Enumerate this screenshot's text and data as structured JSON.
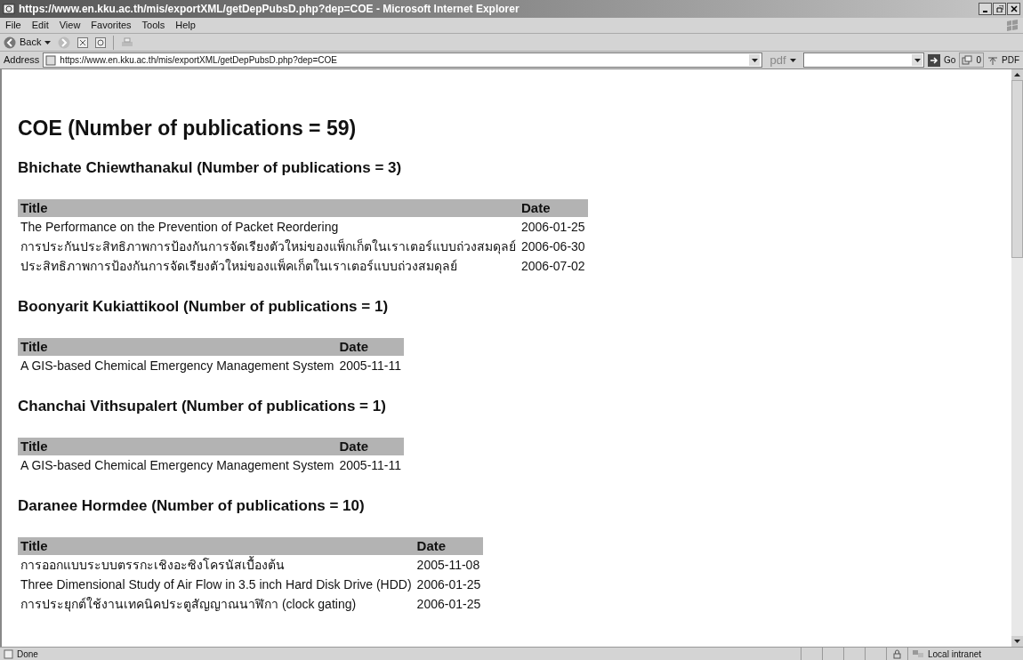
{
  "window": {
    "title": "https://www.en.kku.ac.th/mis/exportXML/getDepPubsD.php?dep=COE - Microsoft Internet Explorer"
  },
  "menu": [
    "File",
    "Edit",
    "View",
    "Favorites",
    "Tools",
    "Help"
  ],
  "toolbar": {
    "back_label": "Back"
  },
  "address_bar": {
    "label": "Address",
    "url": "https://www.en.kku.ac.th/mis/exportXML/getDepPubsD.php?dep=COE",
    "search_label": "pdf",
    "go_label": "Go",
    "count": "0",
    "pdf_label": "PDF"
  },
  "page": {
    "heading": "COE (Number of publications = 59)",
    "sections": [
      {
        "heading": "Bhichate Chiewthanakul (Number of publications = 3)",
        "columns": [
          "Title",
          "Date"
        ],
        "rows": [
          [
            "The Performance on the Prevention of Packet Reordering",
            "2006-01-25"
          ],
          [
            "การประกันประสิทธิภาพการป้องกันการจัดเรียงตัวใหม่ของแพ็กเก็ตในเราเตอร์แบบถ่วงสมดุลย์",
            "2006-06-30"
          ],
          [
            "ประสิทธิภาพการป้องกันการจัดเรียงตัวใหม่ของแพ็คเก็ตในเราเตอร์แบบถ่วงสมดุลย์",
            "2006-07-02"
          ]
        ]
      },
      {
        "heading": "Boonyarit Kukiattikool (Number of publications = 1)",
        "columns": [
          "Title",
          "Date"
        ],
        "rows": [
          [
            "A GIS-based Chemical Emergency Management System",
            "2005-11-11"
          ]
        ]
      },
      {
        "heading": "Chanchai Vithsupalert (Number of publications = 1)",
        "columns": [
          "Title",
          "Date"
        ],
        "rows": [
          [
            "A GIS-based Chemical Emergency Management System",
            "2005-11-11"
          ]
        ]
      },
      {
        "heading": "Daranee Hormdee (Number of publications = 10)",
        "columns": [
          "Title",
          "Date"
        ],
        "rows": [
          [
            "การออกแบบระบบตรรกะเชิงอะซิงโครนัสเบื้องต้น",
            "2005-11-08"
          ],
          [
            "Three Dimensional Study of Air Flow in 3.5 inch Hard Disk Drive (HDD)",
            "2006-01-25"
          ],
          [
            "การประยุกต์ใช้งานเทคนิคประตูสัญญาณนาฬิกา (clock gating)",
            "2006-01-25"
          ]
        ]
      }
    ]
  },
  "status_bar": {
    "text": "Done",
    "zone": "Local intranet"
  }
}
